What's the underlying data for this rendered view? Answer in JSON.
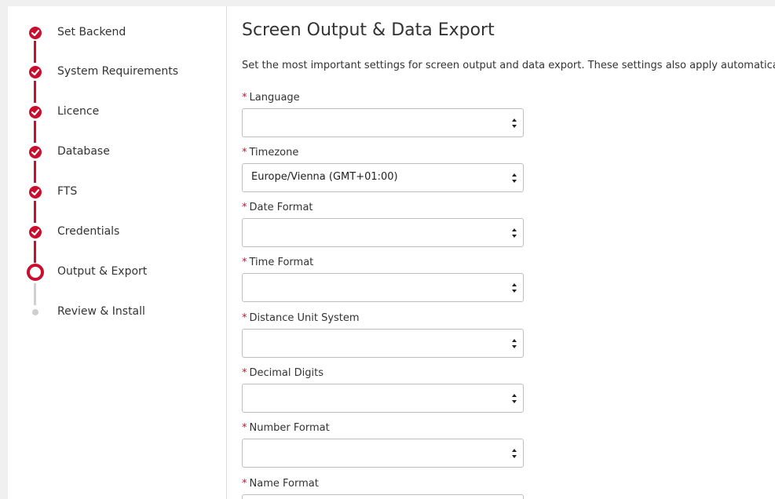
{
  "sidebar": {
    "steps": [
      {
        "label": "Set Backend",
        "state": "done"
      },
      {
        "label": "System Requirements",
        "state": "done"
      },
      {
        "label": "Licence",
        "state": "done"
      },
      {
        "label": "Database",
        "state": "done"
      },
      {
        "label": "FTS",
        "state": "done"
      },
      {
        "label": "Credentials",
        "state": "done"
      },
      {
        "label": "Output & Export",
        "state": "current"
      },
      {
        "label": "Review & Install",
        "state": "pending"
      }
    ]
  },
  "main": {
    "title": "Screen Output & Data Export",
    "description": "Set the most important settings for screen output and data export. These settings also apply automatically",
    "required_marker": "*",
    "fields": [
      {
        "label": "Language",
        "value": ""
      },
      {
        "label": "Timezone",
        "value": "Europe/Vienna (GMT+01:00)"
      },
      {
        "label": "Date Format",
        "value": ""
      },
      {
        "label": "Time Format",
        "value": ""
      },
      {
        "label": "Distance Unit System",
        "value": ""
      },
      {
        "label": "Decimal Digits",
        "value": ""
      },
      {
        "label": "Number Format",
        "value": ""
      },
      {
        "label": "Name Format",
        "value": ""
      }
    ]
  },
  "colors": {
    "accent": "#c8102e",
    "pending": "#cfcfcf"
  }
}
